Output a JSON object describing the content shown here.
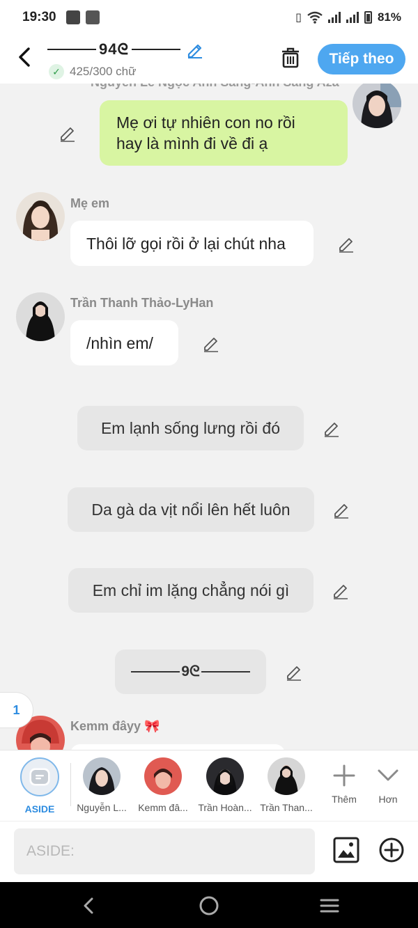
{
  "status_bar": {
    "time": "19:30",
    "battery": "81%"
  },
  "header": {
    "title": "94ᘓ",
    "char_count": "425/300 chữ",
    "next_button": "Tiếp theo"
  },
  "messages": [
    {
      "sender": "Nguyễn Lê Ngọc Anh Sang-Anh Sang Aza",
      "text": "Mẹ ơi tự nhiên con no rồi\nhay là mình đi về đi ạ",
      "side": "right",
      "style": "green"
    },
    {
      "sender": "Mẹ em",
      "text": "Thôi lỡ gọi rồi ở lại chút nha",
      "side": "left",
      "style": "white"
    },
    {
      "sender": "Trần Thanh Thảo-LyHan",
      "text": "/nhìn em/",
      "side": "left",
      "style": "white"
    },
    {
      "sender": "",
      "text": "Em lạnh sống lưng rồi đó",
      "side": "center",
      "style": "grey"
    },
    {
      "sender": "",
      "text": "Da gà da vịt nổi lên hết luôn",
      "side": "center",
      "style": "grey"
    },
    {
      "sender": "",
      "text": "Em chỉ im lặng chẳng nói gì",
      "side": "center",
      "style": "grey"
    },
    {
      "sender": "",
      "text": "9ᘓ",
      "side": "center",
      "style": "grey"
    },
    {
      "sender": "Kemm đâyy 🎀",
      "text": "",
      "side": "left",
      "style": "white"
    }
  ],
  "page_badge": "1",
  "character_tabs": [
    {
      "label": "ASIDE",
      "active": true
    },
    {
      "label": "Nguyễn L...",
      "active": false
    },
    {
      "label": "Kemm đâ...",
      "active": false
    },
    {
      "label": "Trần Hoàn...",
      "active": false
    },
    {
      "label": "Trần Than...",
      "active": false
    }
  ],
  "tools": {
    "more_label": "Thêm",
    "expand_label": "Hơn"
  },
  "input": {
    "placeholder": "ASIDE:"
  },
  "colors": {
    "accent": "#4ea7f0",
    "green_bubble": "#d8f5a2",
    "grey_bubble": "#e6e6e6"
  }
}
